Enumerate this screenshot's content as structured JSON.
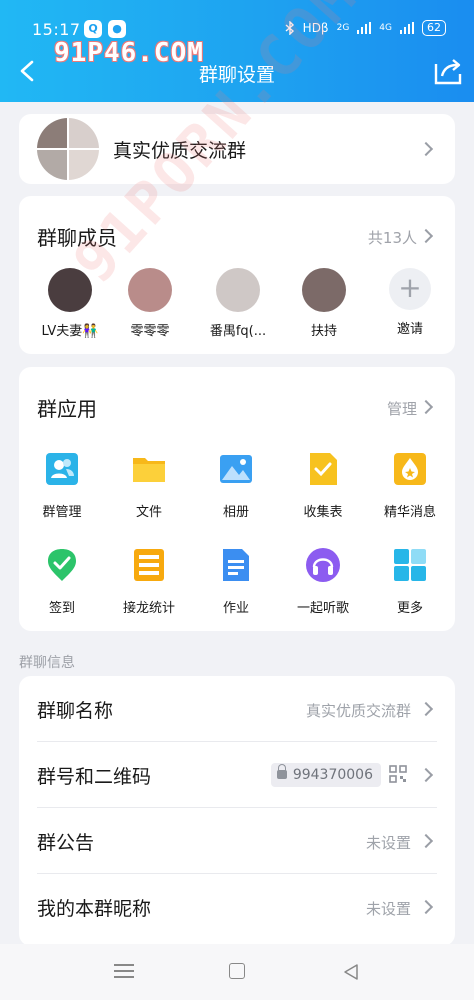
{
  "status": {
    "time": "15:17",
    "app1": "Q",
    "app2": "●",
    "network": "HDβ",
    "signal1": "2G",
    "signal2": "4G",
    "battery": "62"
  },
  "watermark": "91P46.COM",
  "diagonal_watermark": "91PORN.COM",
  "header": {
    "title": "群聊设置"
  },
  "group": {
    "name": "真实优质交流群"
  },
  "members": {
    "title": "群聊成员",
    "count_label": "共13人",
    "items": [
      {
        "name": "LV夫妻👫"
      },
      {
        "name": "零零零"
      },
      {
        "name": "番禺fq(..."
      },
      {
        "name": "扶持"
      }
    ],
    "invite_label": "邀请",
    "invite_symbol": "+"
  },
  "apps": {
    "title": "群应用",
    "manage_label": "管理",
    "items": [
      {
        "label": "群管理",
        "icon": "group-manage-icon",
        "color": "#2bb3e8"
      },
      {
        "label": "文件",
        "icon": "folder-icon",
        "color": "#f7b81a"
      },
      {
        "label": "相册",
        "icon": "photo-album-icon",
        "color": "#3aa0f2"
      },
      {
        "label": "收集表",
        "icon": "form-collect-icon",
        "color": "#f7c21f"
      },
      {
        "label": "精华消息",
        "icon": "essence-icon",
        "color": "#f7b81a"
      },
      {
        "label": "签到",
        "icon": "check-in-icon",
        "color": "#2cc46a"
      },
      {
        "label": "接龙统计",
        "icon": "relay-stats-icon",
        "color": "#f7a90e"
      },
      {
        "label": "作业",
        "icon": "homework-icon",
        "color": "#3b8ef1"
      },
      {
        "label": "一起听歌",
        "icon": "listen-music-icon",
        "color": "#8c5cf0"
      },
      {
        "label": "更多",
        "icon": "more-apps-icon",
        "color": "#27b6e8"
      }
    ]
  },
  "info": {
    "heading": "群聊信息",
    "rows": [
      {
        "label": "群聊名称",
        "value": "真实优质交流群"
      },
      {
        "label": "群号和二维码",
        "value": "994370006"
      },
      {
        "label": "群公告",
        "value": "未设置"
      },
      {
        "label": "我的本群昵称",
        "value": "未设置"
      }
    ]
  }
}
